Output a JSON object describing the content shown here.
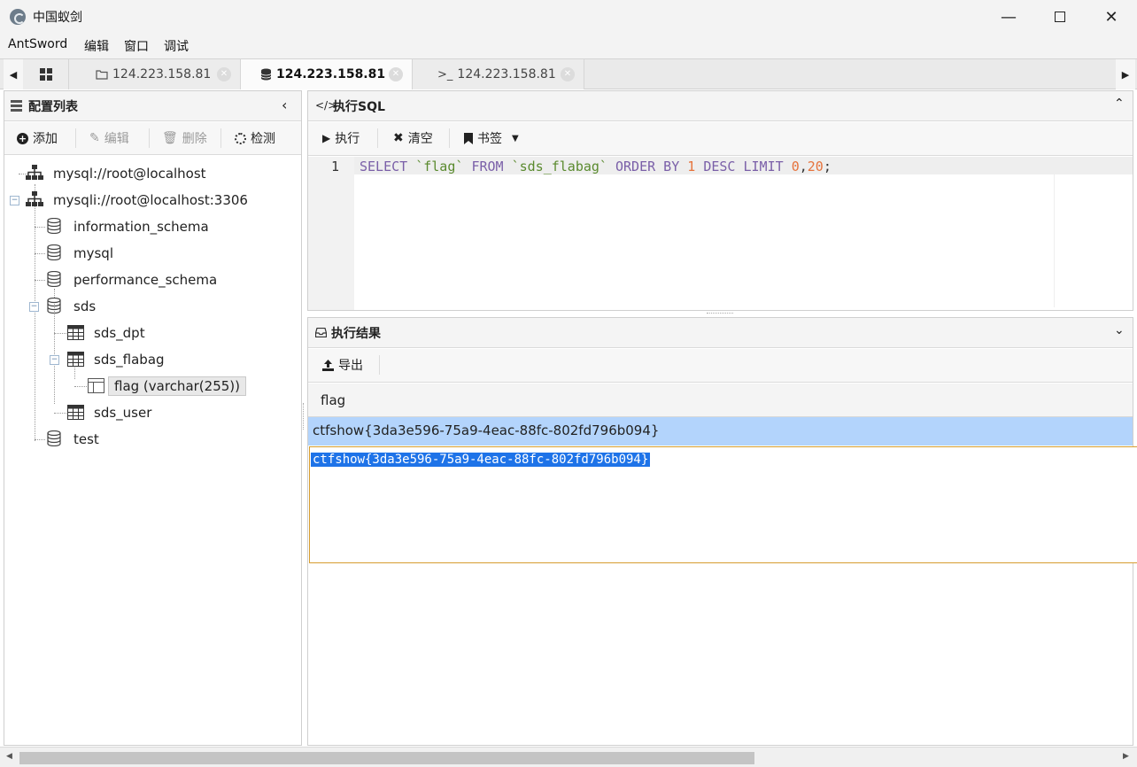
{
  "window": {
    "title": "中国蚁剑",
    "controls": [
      "minimize",
      "maximize",
      "close"
    ]
  },
  "menu": [
    "AntSword",
    "编辑",
    "窗口",
    "调试"
  ],
  "tabs": [
    {
      "icon": "grid-icon",
      "label": ""
    },
    {
      "icon": "folder-icon",
      "label": "124.223.158.81"
    },
    {
      "icon": "database-icon",
      "label": "124.223.158.81",
      "active": true
    },
    {
      "icon": "terminal-icon",
      "label": "124.223.158.81"
    }
  ],
  "left_panel": {
    "title": "配置列表",
    "toolbar": {
      "add": "添加",
      "edit": "编辑",
      "delete": "删除",
      "detect": "检测"
    },
    "tree": {
      "conn1": "mysql://root@localhost",
      "conn2": "mysqli://root@localhost:3306",
      "db_information_schema": "information_schema",
      "db_mysql": "mysql",
      "db_performance_schema": "performance_schema",
      "db_sds": "sds",
      "table_sds_dpt": "sds_dpt",
      "table_sds_flabag": "sds_flabag",
      "column_flag": "flag (varchar(255))",
      "table_sds_user": "sds_user",
      "db_test": "test"
    }
  },
  "sql_panel": {
    "title": "执行SQL",
    "toolbar": {
      "execute": "执行",
      "clear": "清空",
      "bookmark": "书签"
    },
    "line_number": "1",
    "query": {
      "kw1": "SELECT",
      "s1": " ",
      "ident1": "`flag`",
      "s2": " ",
      "kw2": "FROM",
      "s3": " ",
      "ident2": "`sds_flabag`",
      "s4": " ",
      "kw3": "ORDER BY",
      "s5": " ",
      "num1": "1",
      "s6": " ",
      "kw4": "DESC LIMIT",
      "s7": " ",
      "num2": "0",
      "comma": ",",
      "num3": "20",
      "semi": ";"
    }
  },
  "result_panel": {
    "title": "执行结果",
    "toolbar": {
      "export": "导出"
    },
    "columns": [
      "flag"
    ],
    "rows": [
      [
        "ctfshow{3da3e596-75a9-4eac-88fc-802fd796b094}"
      ]
    ],
    "detail_text": "ctfshow{3da3e596-75a9-4eac-88fc-802fd796b094}"
  },
  "colors": {
    "keyword": "#7a5fa8",
    "identifier": "#5a8a2e",
    "number": "#e6733c",
    "selected_row": "#b3d4fc",
    "selection": "#1e73e8"
  }
}
